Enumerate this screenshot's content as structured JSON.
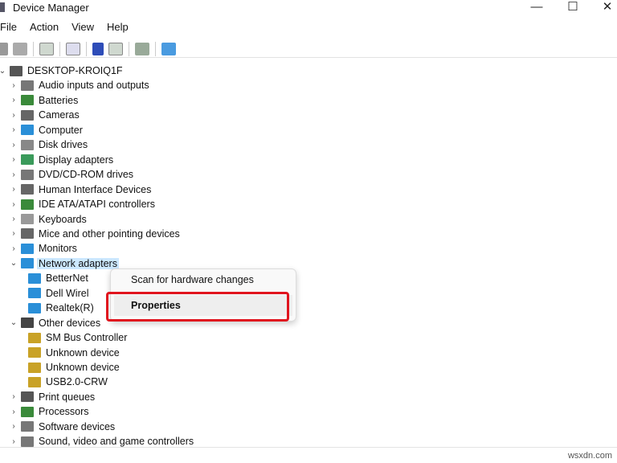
{
  "window": {
    "title": "Device Manager",
    "min": "—",
    "max": "☐",
    "close": "✕"
  },
  "menu": [
    "File",
    "Action",
    "View",
    "Help"
  ],
  "toolbar": [
    "back",
    "forward",
    "show-hide-tree",
    "properties",
    "help",
    "action-view",
    "update-driver",
    "scan-hardware"
  ],
  "tree": {
    "root": "DESKTOP-KROIQ1F",
    "items": [
      {
        "label": "Audio inputs and outputs",
        "color": "#777"
      },
      {
        "label": "Batteries",
        "color": "#3a8a3a"
      },
      {
        "label": "Cameras",
        "color": "#666"
      },
      {
        "label": "Computer",
        "color": "#2a8fd8"
      },
      {
        "label": "Disk drives",
        "color": "#888"
      },
      {
        "label": "Display adapters",
        "color": "#3a9a5a"
      },
      {
        "label": "DVD/CD-ROM drives",
        "color": "#777"
      },
      {
        "label": "Human Interface Devices",
        "color": "#666"
      },
      {
        "label": "IDE ATA/ATAPI controllers",
        "color": "#3a8a3a"
      },
      {
        "label": "Keyboards",
        "color": "#999"
      },
      {
        "label": "Mice and other pointing devices",
        "color": "#666"
      },
      {
        "label": "Monitors",
        "color": "#2a8fd8"
      },
      {
        "label": "Network adapters",
        "color": "#2a8fd8",
        "expanded": true,
        "children": [
          "BetterNet",
          "Dell Wirel",
          "Realtek(R)"
        ]
      },
      {
        "label": "Other devices",
        "color": "#444",
        "expanded": true,
        "children": [
          "SM Bus Controller",
          "Unknown device",
          "Unknown device",
          "USB2.0-CRW"
        ]
      },
      {
        "label": "Print queues",
        "color": "#555"
      },
      {
        "label": "Processors",
        "color": "#3a8a3a"
      },
      {
        "label": "Software devices",
        "color": "#777"
      },
      {
        "label": "Sound, video and game controllers",
        "color": "#777"
      }
    ]
  },
  "context_menu": {
    "scan": "Scan for hardware changes",
    "properties": "Properties"
  },
  "watermark": "wsxdn.com"
}
